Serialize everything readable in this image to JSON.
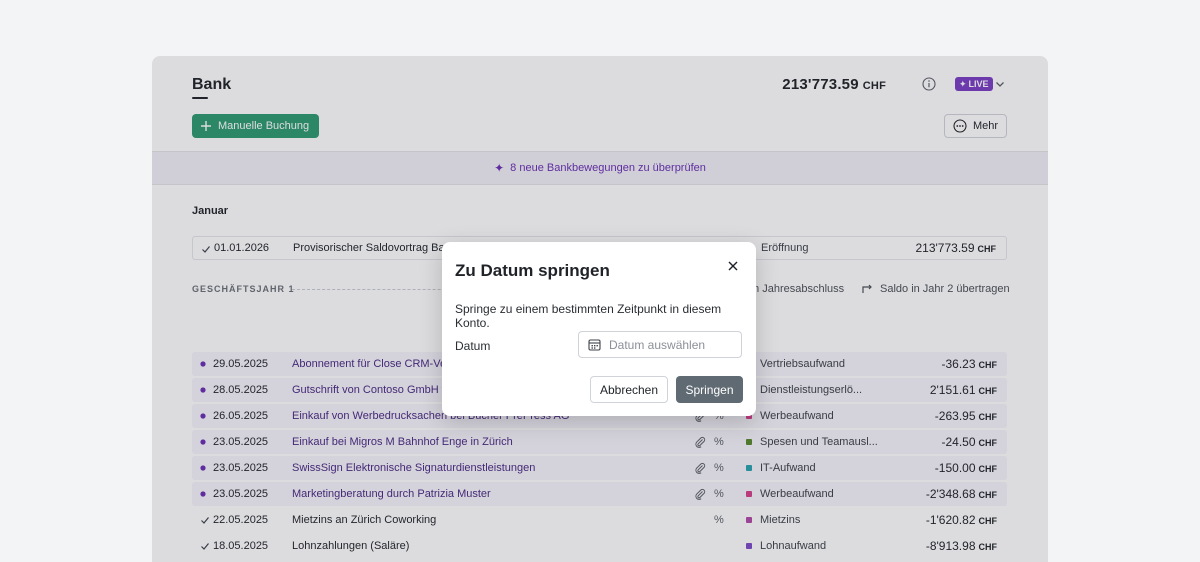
{
  "header": {
    "title": "Bank",
    "balance": "213'773.59",
    "currency": "CHF",
    "live_label": "LIVE",
    "new_booking_label": "Manuelle Buchung",
    "more_label": "Mehr"
  },
  "banner": {
    "text": "8 neue Bankbewegungen zu überprüfen"
  },
  "section": {
    "month": "Januar"
  },
  "opening_row": {
    "date": "01.01.2026",
    "description": "Provisorischer Saldovortrag Bank",
    "category": "Eröffnung",
    "amount": "213'773.59",
    "currency": "CHF"
  },
  "fiscal_year": {
    "label": "GESCHÄFTSJAHR 1",
    "action_close": "m Jahresabschluss",
    "action_transfer": "Saldo in Jahr 2 übertragen"
  },
  "transactions": [
    {
      "date": "29.05.2025",
      "description": "Abonnement für Close CRM-Ver",
      "category": "Vertriebsaufwand",
      "cat_color": "#d63f8c",
      "amount": "-36.23",
      "currency": "CHF",
      "status": "pending",
      "attachment": false,
      "percent": false
    },
    {
      "date": "28.05.2025",
      "description": "Gutschrift von Contoso GmbH fü",
      "category": "Dienstleistungserlö...",
      "cat_color": "#d63f8c",
      "amount": "2'151.61",
      "currency": "CHF",
      "status": "pending",
      "attachment": false,
      "percent": false
    },
    {
      "date": "26.05.2025",
      "description": "Einkauf von Werbedrucksachen bei Bücher PrePress AG",
      "category": "Werbeaufwand",
      "cat_color": "#d63f8c",
      "amount": "-263.95",
      "currency": "CHF",
      "status": "pending",
      "attachment": true,
      "percent": true
    },
    {
      "date": "23.05.2025",
      "description": "Einkauf bei Migros M Bahnhof Enge in Zürich",
      "category": "Spesen und Teamausl...",
      "cat_color": "#5a8a2e",
      "amount": "-24.50",
      "currency": "CHF",
      "status": "pending",
      "attachment": true,
      "percent": true
    },
    {
      "date": "23.05.2025",
      "description": "SwissSign Elektronische Signaturdienstleistungen",
      "category": "IT-Aufwand",
      "cat_color": "#2aa3b0",
      "amount": "-150.00",
      "currency": "CHF",
      "status": "pending",
      "attachment": true,
      "percent": true
    },
    {
      "date": "23.05.2025",
      "description": "Marketingberatung durch Patrizia Muster",
      "category": "Werbeaufwand",
      "cat_color": "#d63f8c",
      "amount": "-2'348.68",
      "currency": "CHF",
      "status": "pending",
      "attachment": true,
      "percent": true
    },
    {
      "date": "22.05.2025",
      "description": "Mietzins an Zürich Coworking",
      "category": "Mietzins",
      "cat_color": "#b04aa8",
      "amount": "-1'620.82",
      "currency": "CHF",
      "status": "done",
      "attachment": false,
      "percent": true
    },
    {
      "date": "18.05.2025",
      "description": "Lohnzahlungen (Saläre)",
      "category": "Lohnaufwand",
      "cat_color": "#7d4cc9",
      "amount": "-8'913.98",
      "currency": "CHF",
      "status": "done",
      "attachment": false,
      "percent": false
    }
  ],
  "dialog": {
    "title": "Zu Datum springen",
    "text": "Springe zu einem bestimmten Zeitpunkt in diesem Konto.",
    "date_label": "Datum",
    "date_placeholder": "Datum auswählen",
    "cancel_label": "Abbrechen",
    "confirm_label": "Springen"
  },
  "colors": {
    "primary_green": "#2e9a72",
    "brand_purple": "#7b3fc6",
    "pending_dot": "#6b2fb5"
  }
}
